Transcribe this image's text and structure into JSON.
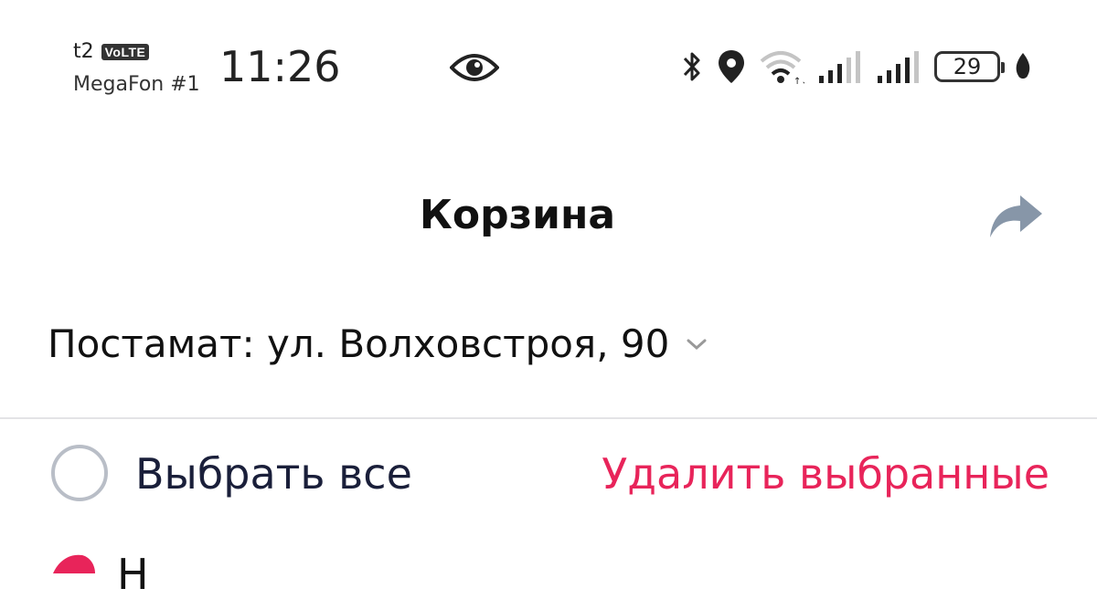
{
  "status_bar": {
    "carrier_short": "t2",
    "volte_badge": "VoLTE",
    "carrier_name": "MegaFon #1",
    "time": "11:26",
    "battery_level": "29",
    "icons": [
      "eye-icon",
      "bluetooth-icon",
      "location-icon",
      "wifi-icon",
      "signal-icon",
      "signal-icon",
      "battery-icon",
      "leaf-icon"
    ]
  },
  "header": {
    "title": "Корзина",
    "share_icon": "share-arrow-icon"
  },
  "delivery": {
    "address": "Постамат: ул. Волховстроя, 90",
    "chevron_icon": "chevron-down-icon"
  },
  "selection": {
    "select_all_label": "Выбрать все",
    "delete_selected_label": "Удалить выбранные"
  },
  "next_row": {
    "partial_text": "Н"
  },
  "colors": {
    "accent": "#e8245a",
    "share_icon": "#8796a8",
    "radio_border": "#b9bec7",
    "divider": "#e3e3e6"
  }
}
